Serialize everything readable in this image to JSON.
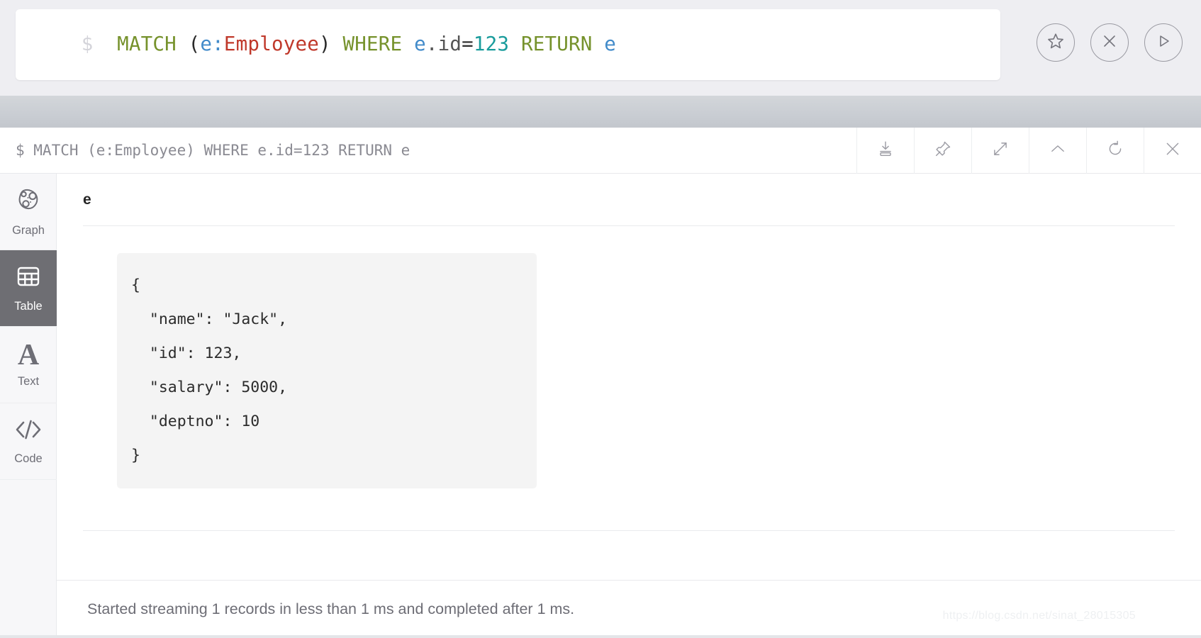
{
  "editor": {
    "prompt": "$",
    "query_plain": "MATCH (e:Employee) WHERE e.id=123 RETURN e",
    "tokens": {
      "kw_match": "MATCH",
      "space1": " ",
      "paren_open": "(",
      "var_e1": "e",
      "colon": ":",
      "label": "Employee",
      "paren_close": ")",
      "space2": " ",
      "kw_where": "WHERE",
      "space3": " ",
      "var_e2": "e",
      "prop_id": ".id",
      "op_eq": "=",
      "num_123": "123",
      "space4": " ",
      "kw_return": "RETURN",
      "space5": " ",
      "var_e3": "e"
    },
    "colors": {
      "prompt": "#d4d4da",
      "keyword": "#76922c",
      "variable": "#428bca",
      "label": "#c0392b",
      "number": "#1a9c9c",
      "property": "#555555",
      "background": "#ffffff"
    },
    "actions": [
      {
        "name": "favorite-icon",
        "label": "Favorite"
      },
      {
        "name": "close-icon",
        "label": "Clear"
      },
      {
        "name": "play-icon",
        "label": "Run"
      }
    ]
  },
  "frame": {
    "query_text": "$ MATCH (e:Employee) WHERE e.id=123 RETURN e",
    "tools": [
      {
        "name": "download-icon",
        "label": "Download"
      },
      {
        "name": "pin-icon",
        "label": "Pin"
      },
      {
        "name": "expand-icon",
        "label": "Fullscreen"
      },
      {
        "name": "chevron-up-icon",
        "label": "Collapse"
      },
      {
        "name": "refresh-icon",
        "label": "Rerun"
      },
      {
        "name": "close-icon",
        "label": "Close"
      }
    ]
  },
  "sidebar": {
    "items": [
      {
        "label": "Graph",
        "icon": "graph-icon",
        "active": false
      },
      {
        "label": "Table",
        "icon": "table-icon",
        "active": true
      },
      {
        "label": "Text",
        "icon": "text-icon",
        "active": false
      },
      {
        "label": "Code",
        "icon": "code-icon",
        "active": false
      }
    ]
  },
  "result": {
    "column_header": "e",
    "json_value": "{\n  \"name\": \"Jack\",\n  \"id\": 123,\n  \"salary\": 5000,\n  \"deptno\": 10\n}",
    "record": {
      "name": "Jack",
      "id": "123",
      "salary": "5000",
      "deptno": "10"
    }
  },
  "status": {
    "message": "Started streaming 1 records in less than 1 ms and completed after 1 ms.",
    "record_count": "1",
    "stream_time": "less than 1 ms",
    "completed_time": "1 ms"
  },
  "watermark": {
    "text": "https://blog.csdn.net/sinat_28015305"
  }
}
